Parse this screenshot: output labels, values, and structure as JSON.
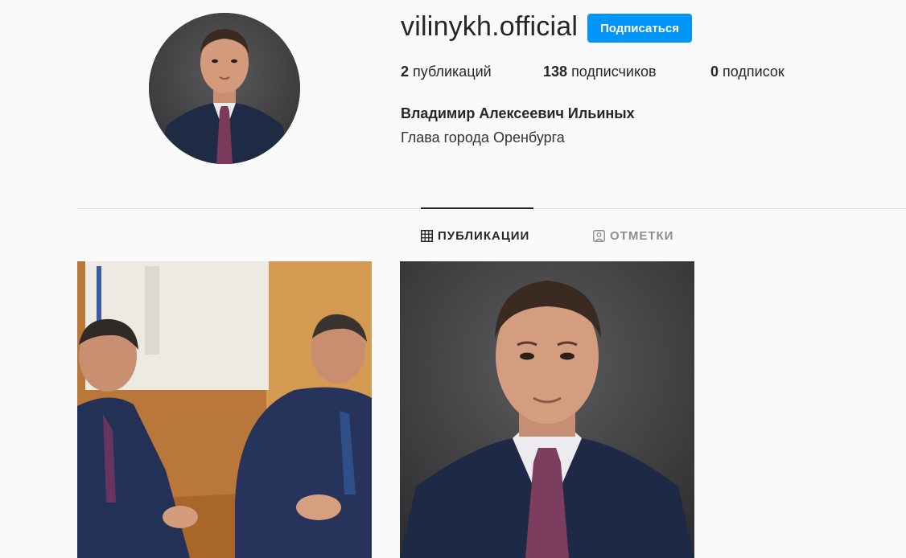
{
  "profile": {
    "username": "vilinykh.official",
    "follow_label": "Подписаться",
    "full_name": "Владимир Алексеевич Ильиных",
    "bio": "Глава города Оренбурга"
  },
  "stats": {
    "posts_count": "2",
    "posts_label": "публикаций",
    "followers_count": "138",
    "followers_label": "подписчиков",
    "following_count": "0",
    "following_label": "подписок"
  },
  "tabs": [
    {
      "label": "ПУБЛИКАЦИИ",
      "icon": "grid-icon",
      "active": true
    },
    {
      "label": "ОТМЕТКИ",
      "icon": "tagged-user-icon",
      "active": false
    }
  ],
  "colors": {
    "accent": "#0095f6",
    "background": "#fafafa",
    "text": "#262626",
    "muted": "#8e8e8e"
  }
}
